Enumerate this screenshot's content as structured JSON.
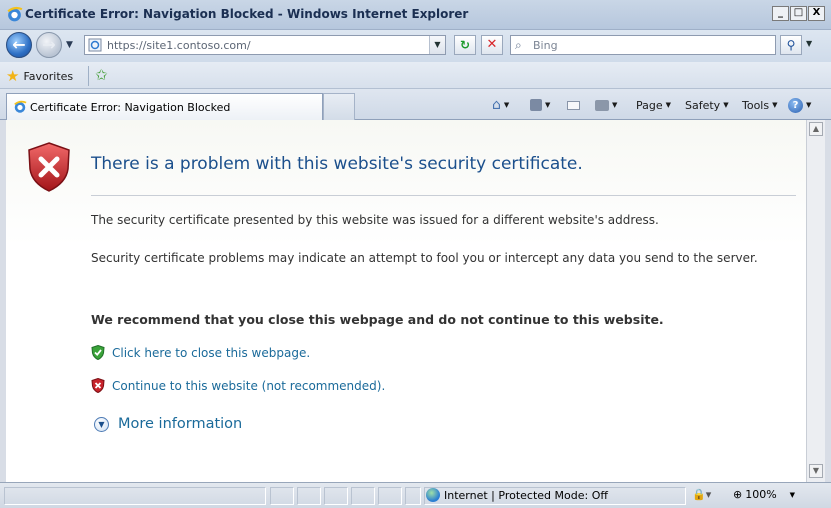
{
  "window": {
    "title": "Certificate Error: Navigation Blocked - Windows Internet Explorer",
    "minimize_label": "_",
    "maximize_label": "□",
    "close_label": "X"
  },
  "address_bar": {
    "url": "https://site1.contoso.com/",
    "search_placeholder": "Bing"
  },
  "favorites_bar": {
    "favorites_label": "Favorites"
  },
  "tabs": [
    {
      "label": "Certificate Error: Navigation Blocked",
      "active": true
    }
  ],
  "command_bar": {
    "page_label": "Page",
    "safety_label": "Safety",
    "tools_label": "Tools"
  },
  "content": {
    "title": "There is a problem with this website's security certificate.",
    "paragraph1": "The security certificate presented by this website was issued for a different website's address.",
    "paragraph2": "Security certificate problems may indicate an attempt to fool you or intercept any data you send to the server.",
    "recommendation": "We recommend that you close this webpage and do not continue to this website.",
    "close_link": "Click here to close this webpage.",
    "continue_link": "Continue to this website (not recommended).",
    "more_info": "More information"
  },
  "status_bar": {
    "zone": "Internet | Protected Mode: Off",
    "zoom": "100%"
  },
  "colors": {
    "title_blue": "#1b4f8c",
    "link_blue": "#1a6a9a",
    "shield_red": "#c8232b",
    "shield_green": "#3aa339"
  }
}
